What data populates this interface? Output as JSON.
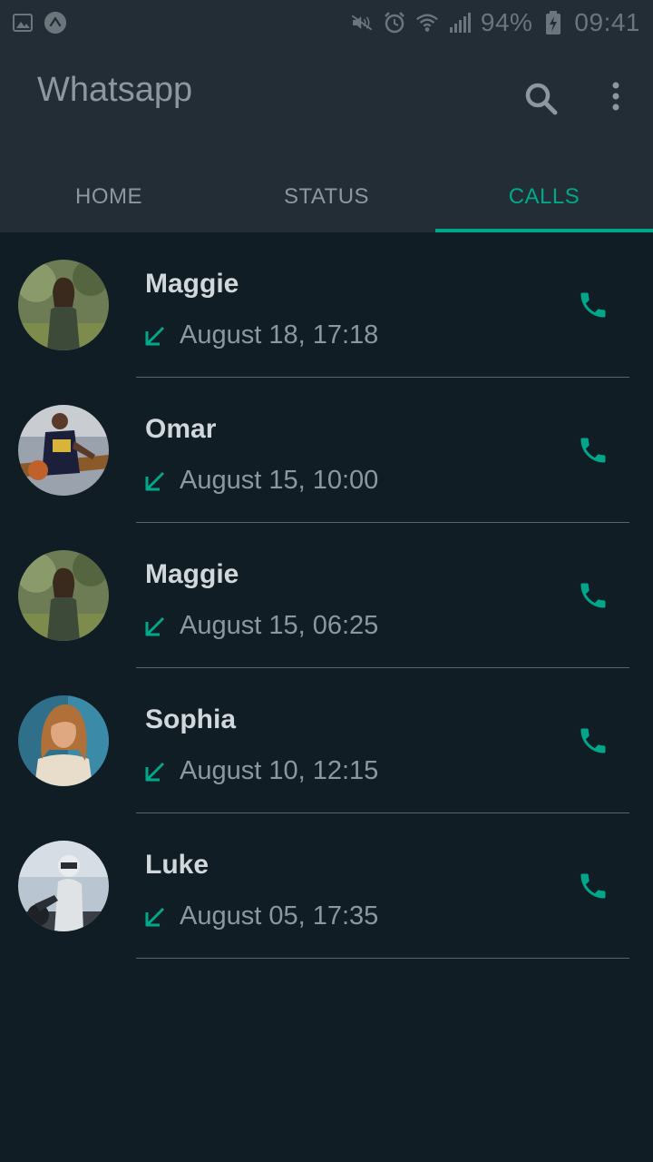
{
  "status_bar": {
    "battery": "94%",
    "time": "09:41",
    "icons": [
      "gallery-icon",
      "app-icon",
      "mute-icon",
      "alarm-icon",
      "wifi-icon",
      "signal-icon",
      "battery-charging-icon"
    ]
  },
  "app_bar": {
    "title": "Whatsapp",
    "search_icon": "search-icon",
    "menu_icon": "more-vert-icon"
  },
  "tabs": [
    {
      "label": "HOME",
      "active": false
    },
    {
      "label": "STATUS",
      "active": false
    },
    {
      "label": "CALLS",
      "active": true
    }
  ],
  "calls": [
    {
      "name": "Maggie",
      "time": "August 18, 17:18",
      "direction": "incoming"
    },
    {
      "name": "Omar",
      "time": "August 15, 10:00",
      "direction": "incoming"
    },
    {
      "name": "Maggie",
      "time": "August 15, 06:25",
      "direction": "incoming"
    },
    {
      "name": "Sophia",
      "time": "August 10, 12:15",
      "direction": "incoming"
    },
    {
      "name": "Luke",
      "time": "August 05, 17:35",
      "direction": "incoming"
    }
  ],
  "colors": {
    "accent": "#00a88a",
    "background": "#101d25",
    "header": "#232d36",
    "name_text": "#d1d7da",
    "secondary_text": "#8d979e"
  }
}
